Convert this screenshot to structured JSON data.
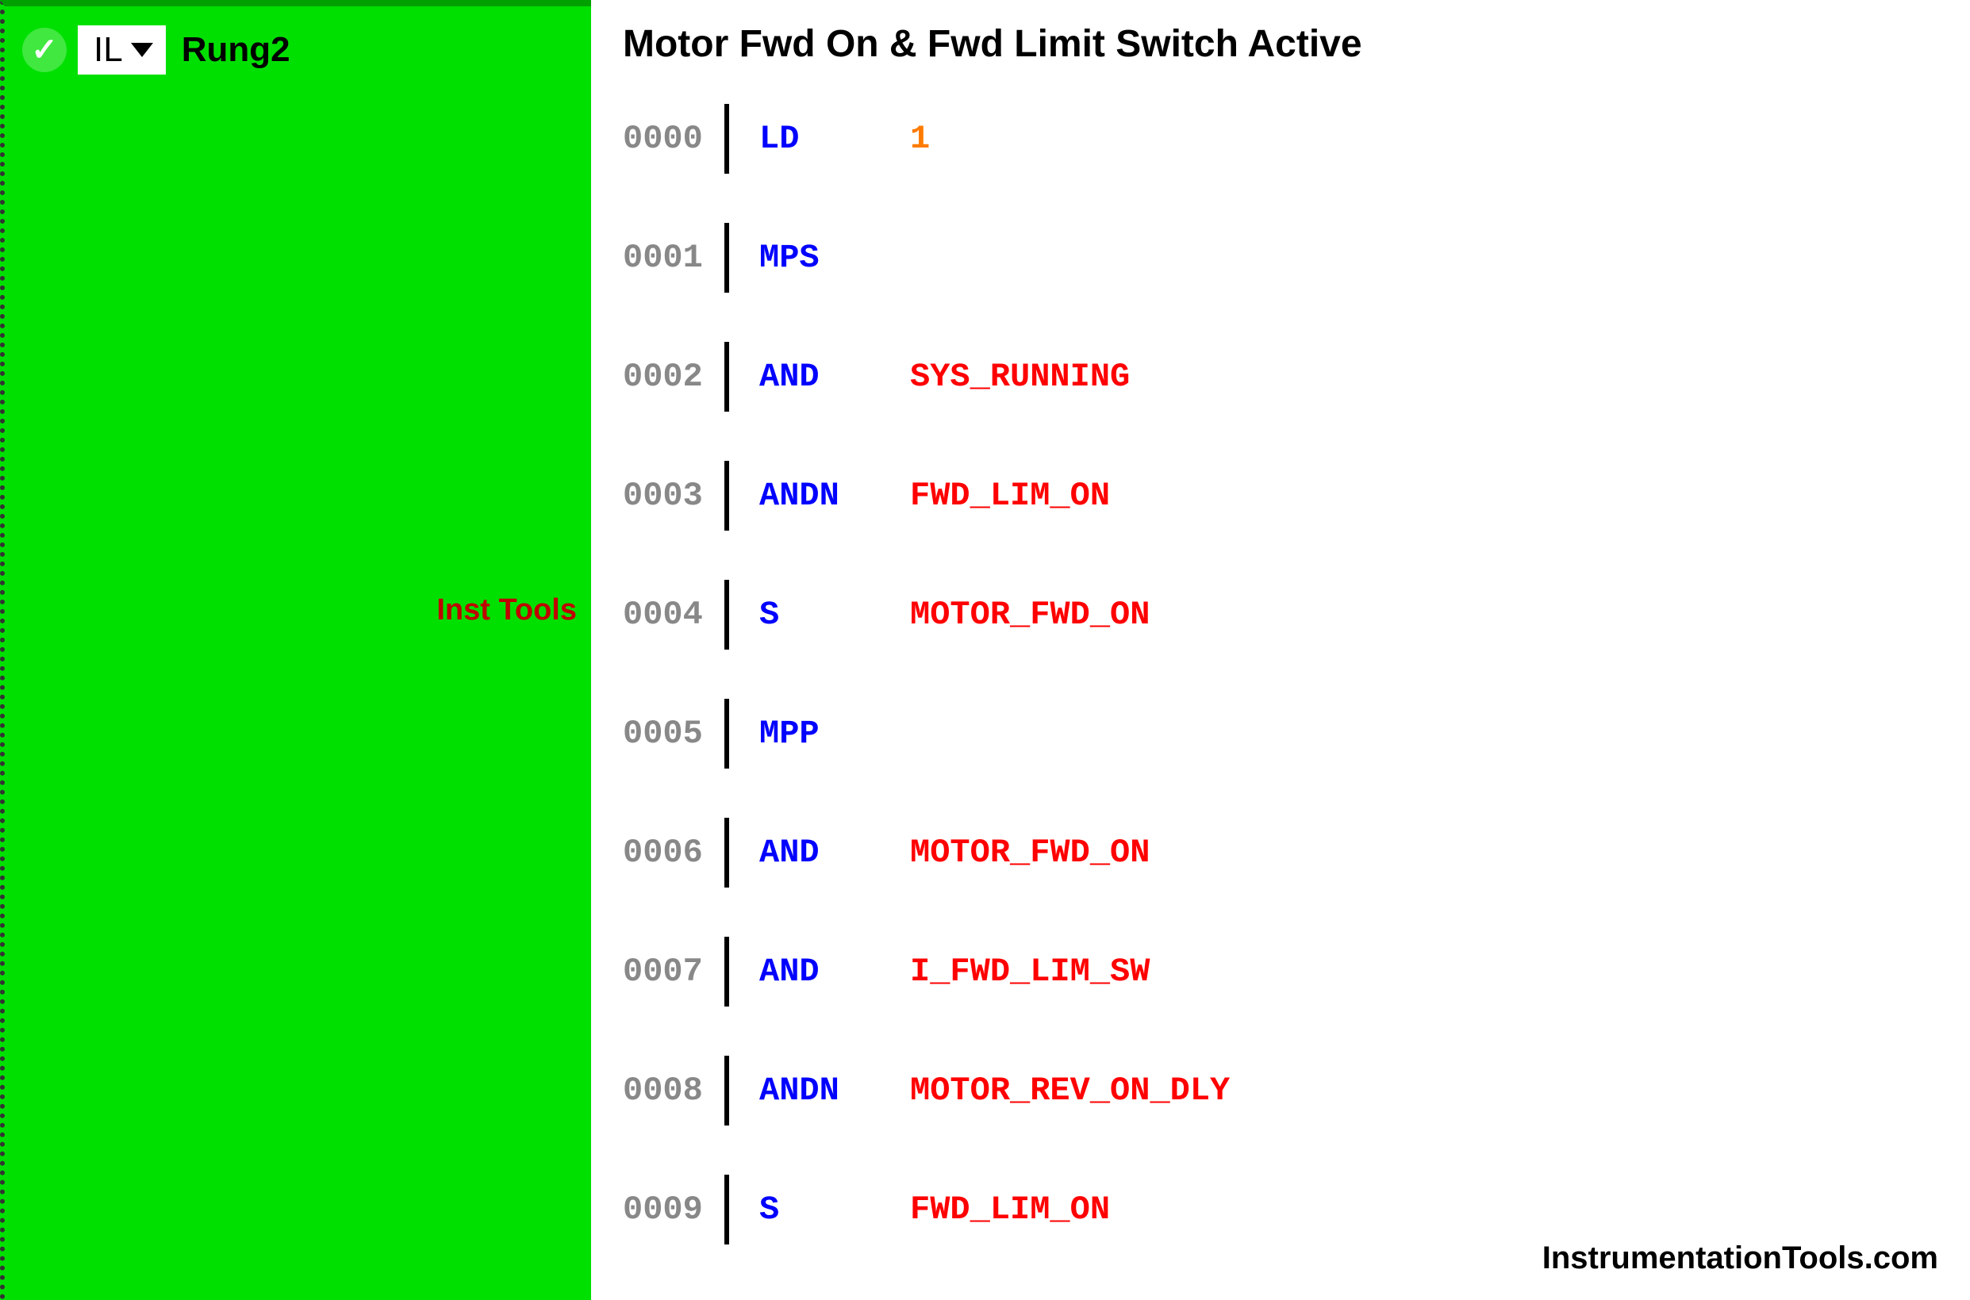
{
  "sidebar": {
    "checkmark": "✓",
    "lang_selected": "IL",
    "rung_label": "Rung2",
    "watermark": "Inst Tools"
  },
  "code": {
    "title": "Motor Fwd On & Fwd Limit Switch Active",
    "lines": [
      {
        "addr": "0000",
        "instr": "LD",
        "arg": "1",
        "argType": "num"
      },
      {
        "addr": "0001",
        "instr": "MPS",
        "arg": "",
        "argType": ""
      },
      {
        "addr": "0002",
        "instr": "AND",
        "arg": "SYS_RUNNING",
        "argType": "tag"
      },
      {
        "addr": "0003",
        "instr": "ANDN",
        "arg": "FWD_LIM_ON",
        "argType": "tag"
      },
      {
        "addr": "0004",
        "instr": "S",
        "arg": "MOTOR_FWD_ON",
        "argType": "tag"
      },
      {
        "addr": "0005",
        "instr": "MPP",
        "arg": "",
        "argType": ""
      },
      {
        "addr": "0006",
        "instr": "AND",
        "arg": "MOTOR_FWD_ON",
        "argType": "tag"
      },
      {
        "addr": "0007",
        "instr": "AND",
        "arg": "I_FWD_LIM_SW",
        "argType": "tag"
      },
      {
        "addr": "0008",
        "instr": "ANDN",
        "arg": "MOTOR_REV_ON_DLY",
        "argType": "tag"
      },
      {
        "addr": "0009",
        "instr": "S",
        "arg": "FWD_LIM_ON",
        "argType": "tag"
      }
    ]
  },
  "footer": "InstrumentationTools.com"
}
